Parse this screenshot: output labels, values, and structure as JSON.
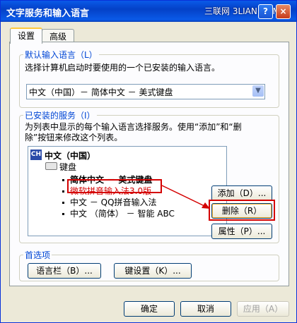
{
  "window": {
    "title": "文字服务和输入语言",
    "watermark": "三联网 3LIAN.COM",
    "help_icon": "?",
    "close_icon": "×"
  },
  "tabs": [
    {
      "label": "设置",
      "active": true
    },
    {
      "label": "高级",
      "active": false
    }
  ],
  "default_language": {
    "legend": "默认输入语言（L）",
    "description": "选择计算机启动时要使用的一个已安装的输入语言。",
    "selected": "中文（中国）－ 简体中文 － 美式键盘"
  },
  "installed_services": {
    "legend": "已安装的服务（I）",
    "description_line1": "为列表中显示的每个输入语言选择服务。使用“添加”和“删",
    "description_line2": "除”按钮来修改这个列表。",
    "language": "中文（中国）",
    "language_icon": "CH",
    "keyboard_label": "键盘",
    "items": [
      "简体中文 － 美式键盘",
      "微软拼音输入法3.0版",
      "中文 － QQ拼音输入法",
      "中文 （简体） － 智能 ABC"
    ],
    "add_button": "添加（D）...",
    "remove_button": "删除（R）",
    "properties_button": "属性（P）..."
  },
  "preferences": {
    "legend": "首选项",
    "language_bar_button": "语言栏（B）...",
    "key_settings_button": "键设置（K）..."
  },
  "footer": {
    "ok": "确定",
    "cancel": "取消",
    "apply": "应用（A）"
  },
  "colors": {
    "titlebar": "#0a5ae8",
    "annotation": "#d40000",
    "legend_text": "#0046d5"
  }
}
